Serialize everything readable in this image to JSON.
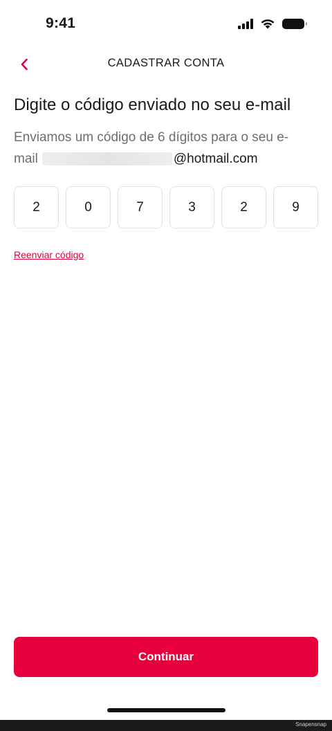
{
  "status_bar": {
    "time": "9:41"
  },
  "header": {
    "title": "CADASTRAR CONTA"
  },
  "content": {
    "heading": "Digite o código enviado no seu e-mail",
    "description_line1": "Enviamos um código de 6 dígitos para o seu e-",
    "email_prefix": "mail",
    "email_domain": "@hotmail.com",
    "code_digits": [
      "2",
      "0",
      "7",
      "3",
      "2",
      "9"
    ],
    "resend_label": "Reenviar código"
  },
  "footer": {
    "continue_label": "Continuar"
  },
  "watermark": "Snapensnap",
  "colors": {
    "accent": "#e8003d",
    "text": "#1a1a1a",
    "muted": "#6e6e6e",
    "border": "#e3e3e3"
  }
}
